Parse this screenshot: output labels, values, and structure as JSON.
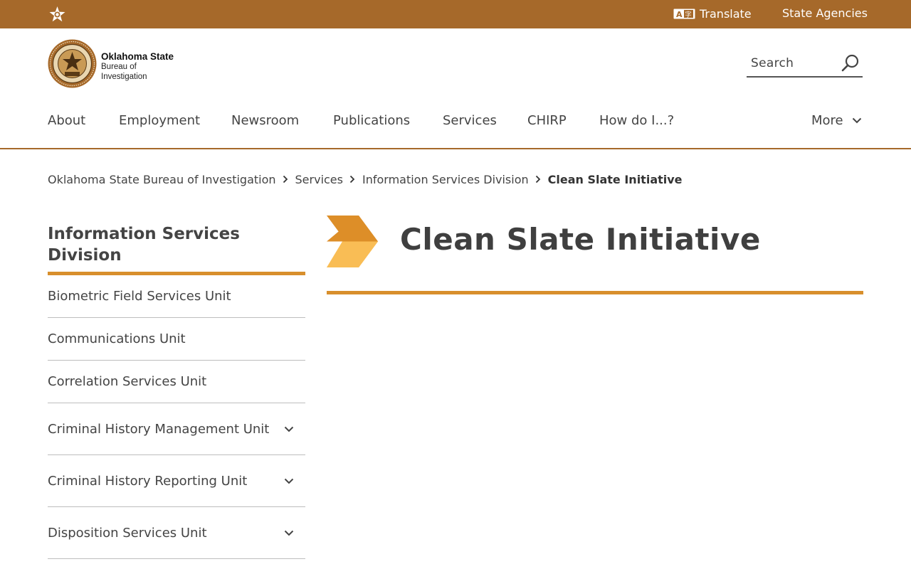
{
  "topbar": {
    "translate_label": "Translate",
    "state_agencies_label": "State Agencies",
    "icons": {
      "ok": "oklahoma-star-icon",
      "translate": "translate-icon"
    }
  },
  "header": {
    "logo": {
      "title": "Oklahoma State",
      "subtitle_line1": "Bureau of",
      "subtitle_line2": "Investigation"
    },
    "search": {
      "placeholder": "Search",
      "value": ""
    }
  },
  "nav": {
    "items": [
      {
        "label": "About"
      },
      {
        "label": "Employment"
      },
      {
        "label": "Newsroom"
      },
      {
        "label": "Publications"
      },
      {
        "label": "Services"
      },
      {
        "label": "CHIRP"
      },
      {
        "label": "How do I...?"
      }
    ],
    "more_label": "More"
  },
  "breadcrumb": {
    "items": [
      {
        "label": "Oklahoma State Bureau of Investigation"
      },
      {
        "label": "Services"
      },
      {
        "label": "Information Services Division"
      }
    ],
    "current": "Clean Slate Initiative"
  },
  "sidebar": {
    "title": "Information Services Division",
    "items": [
      {
        "label": "Biometric Field Services Unit",
        "expandable": false
      },
      {
        "label": "Communications Unit",
        "expandable": false
      },
      {
        "label": "Correlation Services Unit",
        "expandable": false
      },
      {
        "label": "Criminal History Management Unit",
        "expandable": true
      },
      {
        "label": "Criminal History Reporting Unit",
        "expandable": true
      },
      {
        "label": "Disposition Services Unit",
        "expandable": true
      }
    ]
  },
  "main": {
    "title": "Clean Slate Initiative"
  },
  "colors": {
    "topbar": "#a6692a",
    "accent": "#d88f2c",
    "chevron_dark": "#dd8e28",
    "chevron_light": "#f9bd55",
    "text": "#444444"
  }
}
